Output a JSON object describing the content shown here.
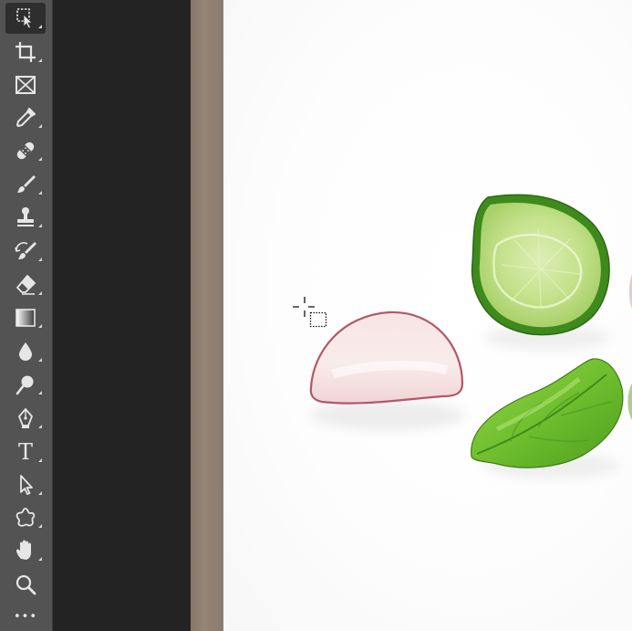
{
  "toolbar": {
    "tools": [
      {
        "name": "object-selection-tool",
        "icon": "object-selection-icon",
        "active": true
      },
      {
        "name": "crop-tool",
        "icon": "crop-icon"
      },
      {
        "name": "frame-tool",
        "icon": "frame-icon"
      },
      {
        "name": "eyedropper-tool",
        "icon": "eyedropper-icon"
      },
      {
        "name": "spot-healing-brush-tool",
        "icon": "bandage-icon"
      },
      {
        "name": "brush-tool",
        "icon": "brush-icon"
      },
      {
        "name": "clone-stamp-tool",
        "icon": "stamp-icon"
      },
      {
        "name": "history-brush-tool",
        "icon": "history-brush-icon"
      },
      {
        "name": "eraser-tool",
        "icon": "eraser-icon"
      },
      {
        "name": "gradient-tool",
        "icon": "gradient-icon"
      },
      {
        "name": "blur-tool",
        "icon": "drop-icon"
      },
      {
        "name": "dodge-tool",
        "icon": "dodge-icon"
      },
      {
        "name": "pen-tool",
        "icon": "pen-icon"
      },
      {
        "name": "type-tool",
        "icon": "type-icon",
        "glyph": "T"
      },
      {
        "name": "path-selection-tool",
        "icon": "arrow-icon"
      },
      {
        "name": "custom-shape-tool",
        "icon": "custom-shape-icon"
      },
      {
        "name": "hand-tool",
        "icon": "hand-icon"
      },
      {
        "name": "zoom-tool",
        "icon": "magnifier-icon"
      },
      {
        "name": "edit-toolbar",
        "icon": "more-icon",
        "glyph": "•••"
      }
    ]
  },
  "canvas": {
    "background": "#ffffff",
    "objects": [
      "radish-slice",
      "cucumber-slice",
      "basil-leaf"
    ],
    "cursor": "object-selection-cursor-icon"
  },
  "colors": {
    "toolbar_bg": "#535353",
    "workspace_bg": "#232323",
    "edge_strip": "#8f7f72",
    "cucumber": "#b6d779",
    "basil": "#7ac43c",
    "radish": "#f4d7d7"
  }
}
